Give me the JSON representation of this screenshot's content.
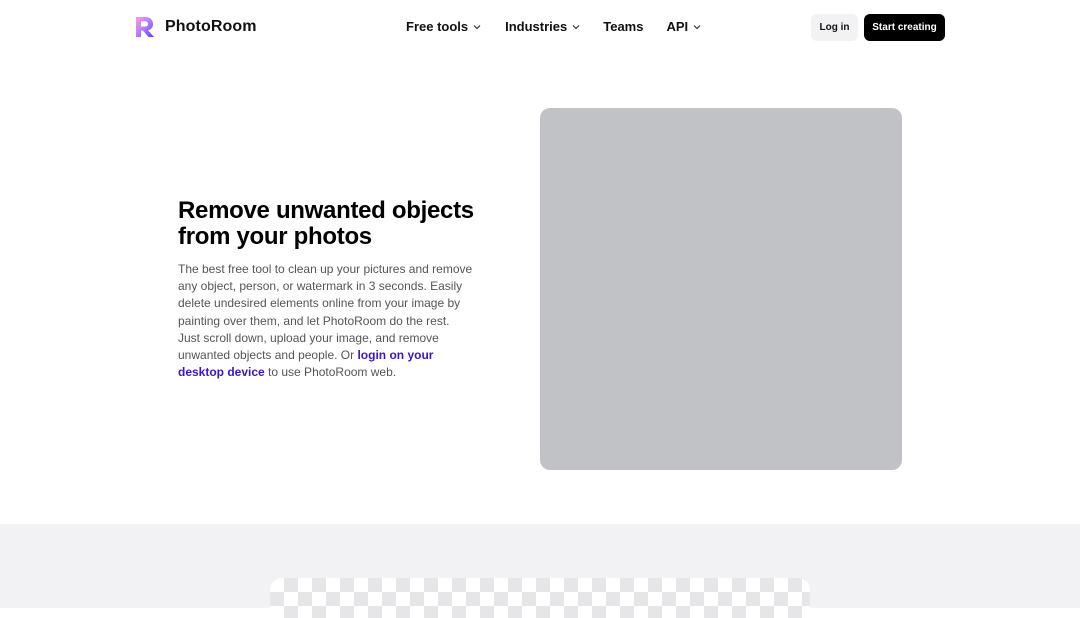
{
  "brand": {
    "name": "PhotoRoom"
  },
  "nav": {
    "items": [
      {
        "label": "Free tools",
        "has_dropdown": true
      },
      {
        "label": "Industries",
        "has_dropdown": true
      },
      {
        "label": "Teams",
        "has_dropdown": false
      },
      {
        "label": "API",
        "has_dropdown": true
      }
    ],
    "login_label": "Log in",
    "cta_label": "Start creating"
  },
  "hero": {
    "title": "Remove unwanted objects from your photos",
    "desc_before_link": "The best free tool to clean up your pictures and remove any object, person, or watermark in 3 seconds. Easily delete undesired elements online from your image by painting over them, and let PhotoRoom do the rest. Just scroll down, upload your image, and remove unwanted objects and people. Or ",
    "desc_link": "login on your desktop device",
    "desc_after_link": " to use PhotoRoom web."
  },
  "colors": {
    "link": "#3b17c4",
    "cta_bg": "#000000",
    "image_placeholder": "#c1c2c6",
    "section_bg": "#f2f2f5"
  }
}
